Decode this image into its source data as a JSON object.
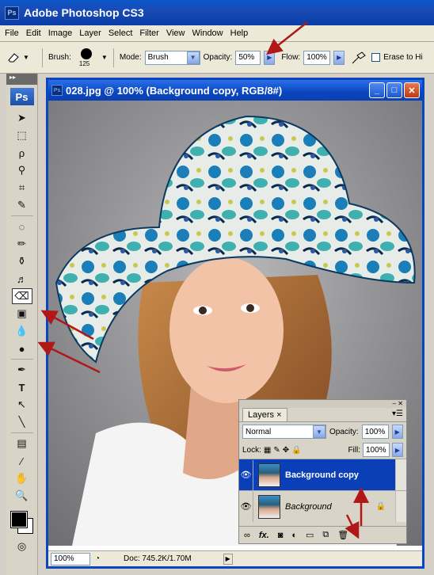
{
  "window": {
    "title": "Adobe Photoshop CS3",
    "logo": "Ps"
  },
  "menu": [
    "File",
    "Edit",
    "Image",
    "Layer",
    "Select",
    "Filter",
    "View",
    "Window",
    "Help"
  ],
  "options": {
    "brush_label": "Brush:",
    "brush_size": "125",
    "mode_label": "Mode:",
    "mode_value": "Brush",
    "opacity_label": "Opacity:",
    "opacity_value": "50%",
    "flow_label": "Flow:",
    "flow_value": "100%",
    "erase_label": "Erase to Hi"
  },
  "toolbox": {
    "badge": "Ps"
  },
  "document": {
    "icon": "Ps",
    "title": "028.jpg @ 100% (Background copy, RGB/8#)",
    "zoom": "100%",
    "info": "Doc: 745.2K/1.70M"
  },
  "layers": {
    "tab": "Layers",
    "blend_mode": "Normal",
    "opacity_label": "Opacity:",
    "opacity_value": "100%",
    "lock_label": "Lock:",
    "fill_label": "Fill:",
    "fill_value": "100%",
    "items": [
      {
        "name": "Background copy",
        "selected": true
      },
      {
        "name": "Background",
        "locked": true
      }
    ]
  },
  "colors": {
    "title_bar": "#0a46c0",
    "selected_layer": "#0a3fb8",
    "annotation_arrow": "#b01818"
  }
}
